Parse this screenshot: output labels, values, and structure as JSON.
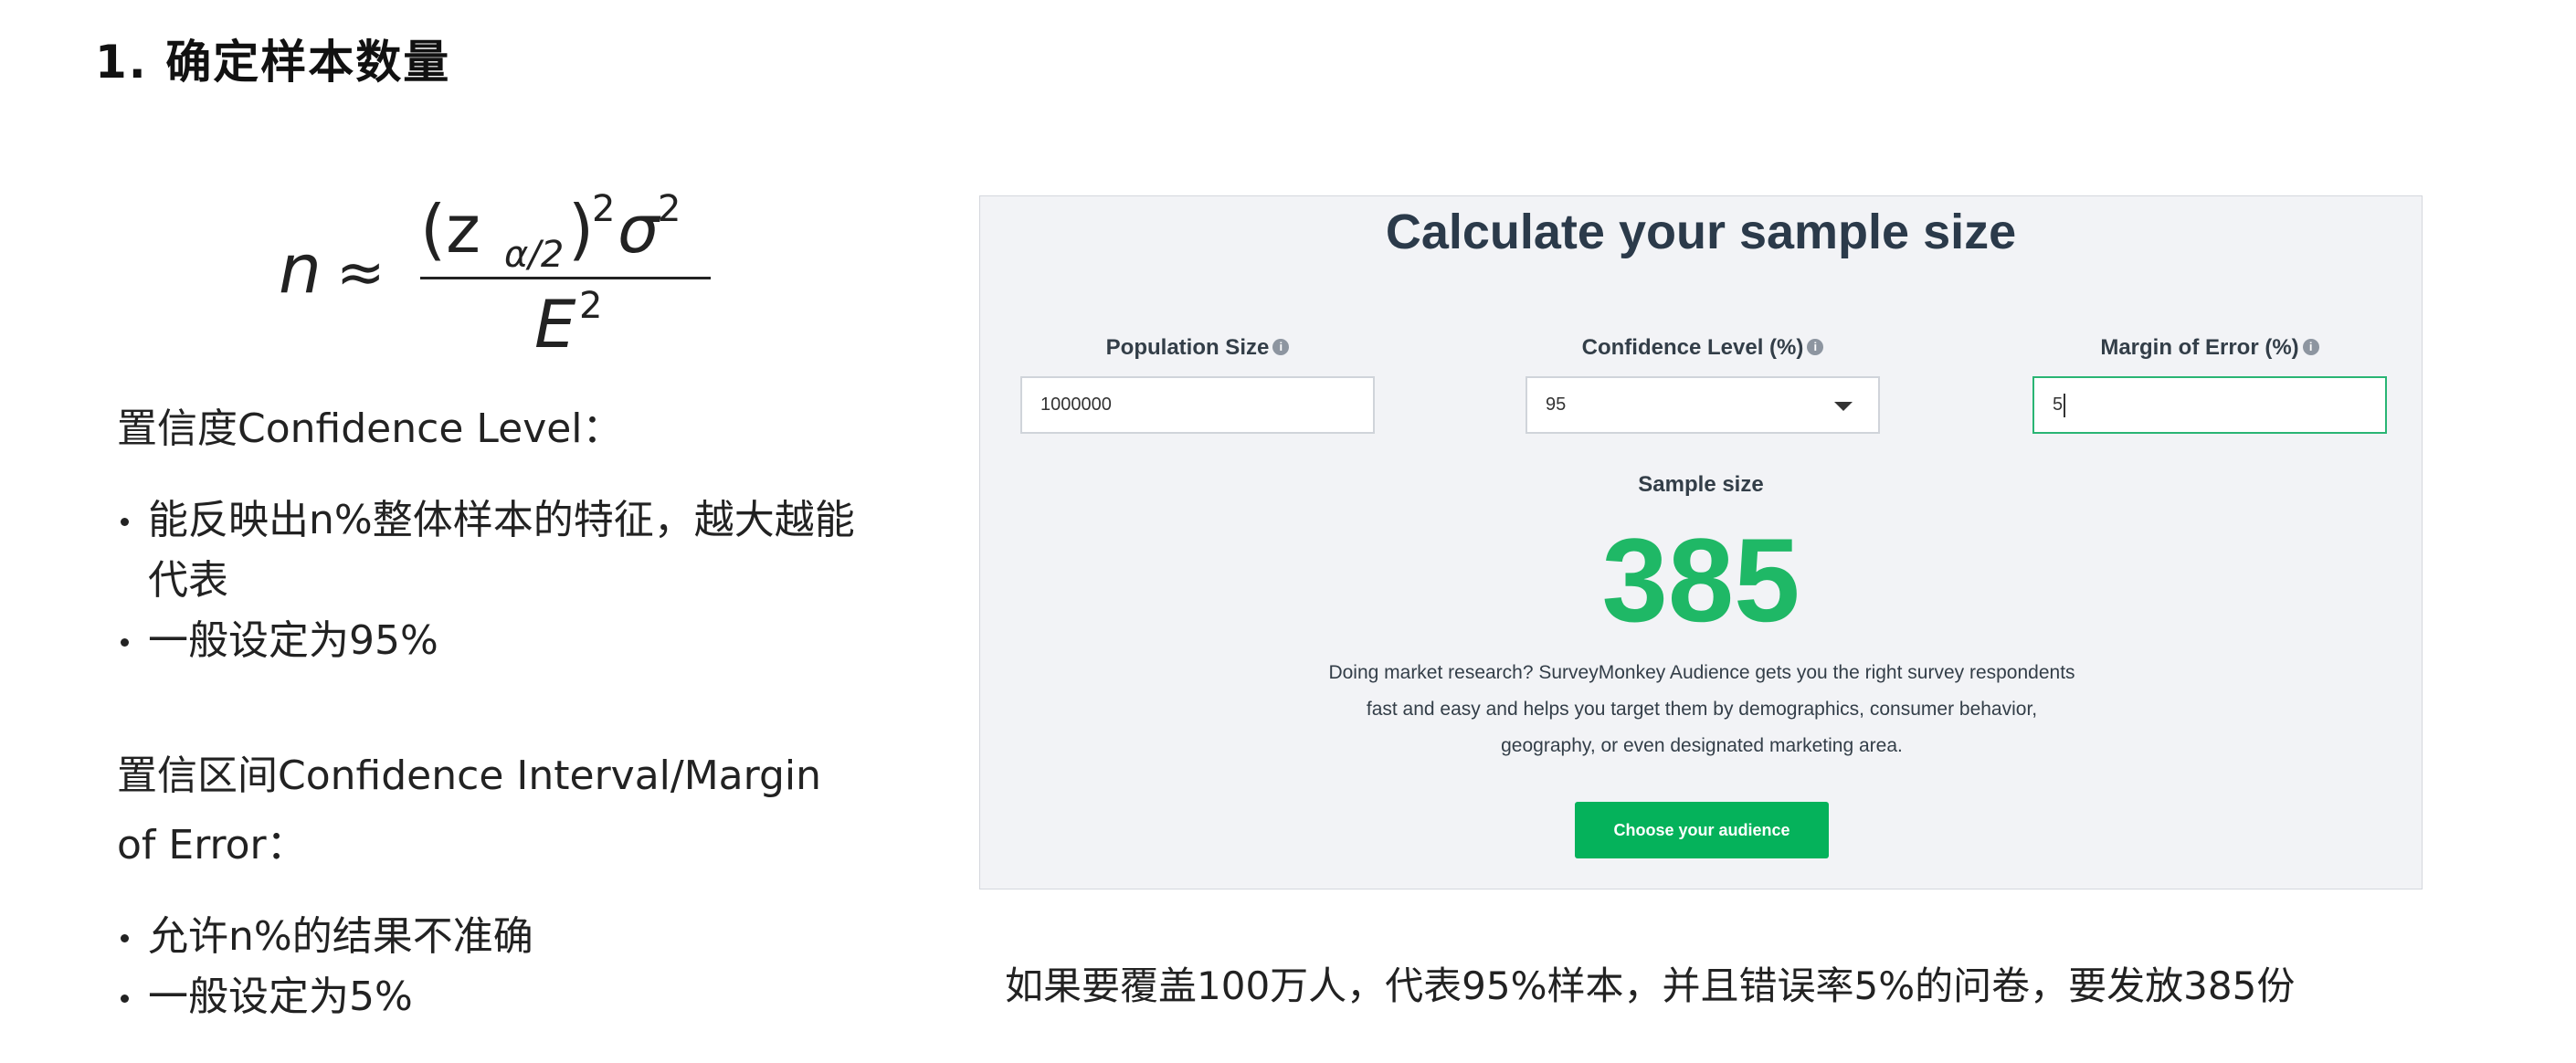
{
  "heading": "1. 确定样本数量",
  "confidence_level": {
    "title": "置信度Confidence Level：",
    "bullets": [
      "能反映出n%整体样本的特征，越大越能代表",
      "一般设定为95%"
    ]
  },
  "confidence_interval": {
    "title": "置信区间Confidence Interval/Margin of Error：",
    "bullets": [
      "允许n%的结果不准确",
      "一般设定为5%"
    ]
  },
  "calculator": {
    "title": "Calculate your sample size",
    "population_label": "Population Size",
    "population_value": "1000000",
    "confidence_label": "Confidence Level (%)",
    "confidence_value": "95",
    "margin_label": "Margin of Error (%)",
    "margin_value": "5",
    "sample_label": "Sample size",
    "sample_value": "385",
    "description": "Doing market research? SurveyMonkey Audience gets you the right survey respondents fast and easy and helps you target them by demographics, consumer behavior, geography, or even designated marketing area.",
    "cta_label": "Choose your audience",
    "info_glyph": "i"
  },
  "conclusion": "如果要覆盖100万人，代表95%样本，并且错误率5%的问卷，要发放385份",
  "colors": {
    "accent_green": "#05b25b",
    "sample_number_green": "#1fb866",
    "panel_bg": "#f2f3f6"
  }
}
